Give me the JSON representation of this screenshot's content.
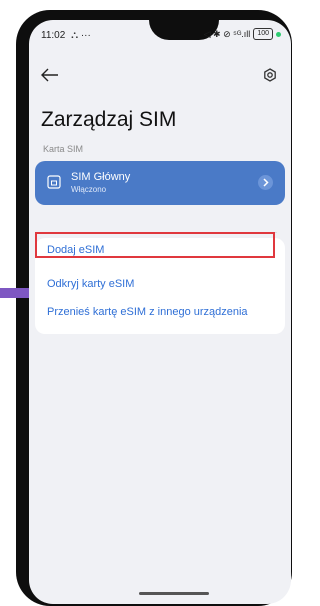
{
  "status_bar": {
    "time": "11:02",
    "extra": "⛬ ···",
    "right_icons": "◁ ✱ ⊘ ⁵ᴳ.ıll",
    "battery": "100"
  },
  "page": {
    "title": "Zarządzaj SIM",
    "section_label": "Karta SIM"
  },
  "sim": {
    "name": "SIM Główny",
    "status": "Włączono"
  },
  "esim": {
    "items": [
      {
        "label": "Dodaj eSIM"
      },
      {
        "label": "Odkryj karty eSIM"
      },
      {
        "label": "Przenieś kartę eSIM z innego urządzenia"
      }
    ]
  },
  "colors": {
    "accent": "#2f6fd6",
    "sim_card": "#4a7ac7",
    "highlight": "#e0383e",
    "background": "#f0f1f5"
  },
  "icons": [
    "back-arrow-icon",
    "settings-icon",
    "sim-card-icon",
    "chevron-right-icon"
  ]
}
